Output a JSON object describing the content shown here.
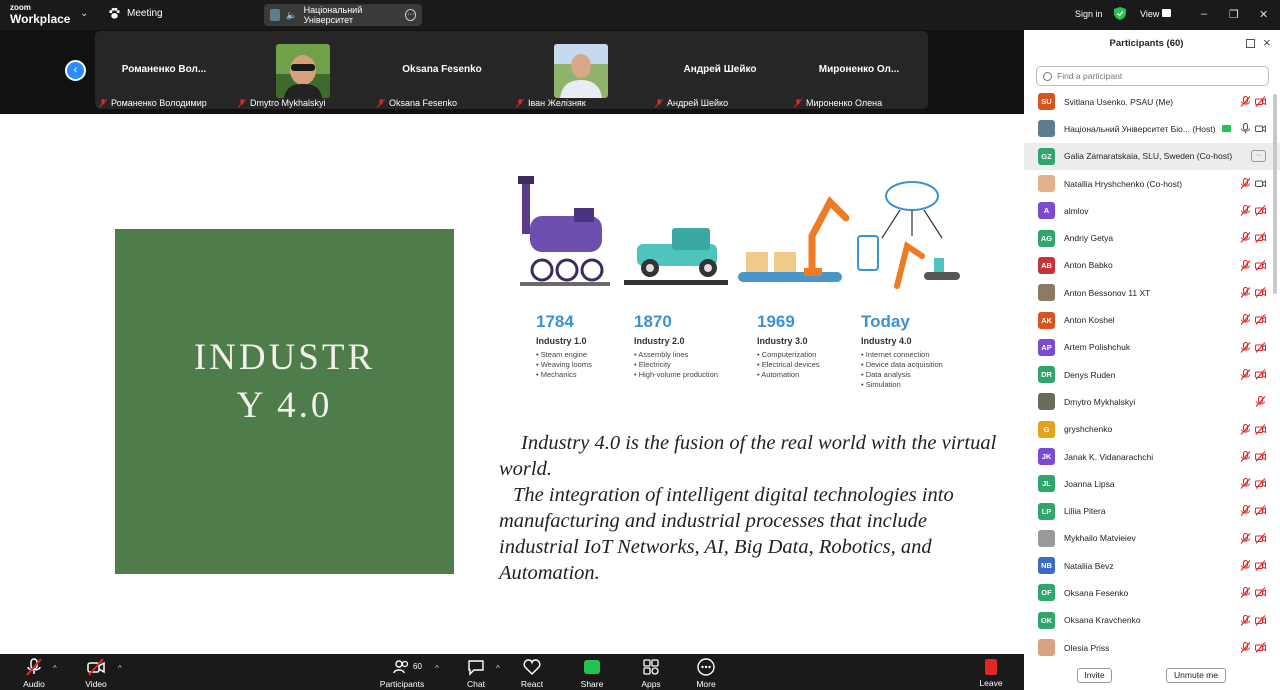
{
  "app": {
    "logo_line1": "zoom",
    "logo_line2": "Workplace",
    "meeting_label": "Meeting"
  },
  "speaker": {
    "name": "Національний Університет"
  },
  "top_right": {
    "signin": "Sign in",
    "view": "View"
  },
  "gallery": [
    {
      "big": "Романенко  Вол...",
      "label": "Романенко Володимир",
      "photo": false
    },
    {
      "big": "",
      "label": "Dmytro Mykhalskyi",
      "photo": true
    },
    {
      "big": "Oksana Fesenko",
      "label": "Oksana Fesenko",
      "photo": false
    },
    {
      "big": "",
      "label": "Іван Желізняк",
      "photo": true
    },
    {
      "big": "Андрей Шейко",
      "label": "Андрей Шейко",
      "photo": false
    },
    {
      "big": "Мироненко  Ол...",
      "label": "Мироненко Олена",
      "photo": false
    }
  ],
  "slide": {
    "title_line1": "INDUSTR",
    "title_line2": "Y 4.0",
    "timeline": [
      {
        "year": "1784",
        "title": "Industry 1.0",
        "items": [
          "Steam engine",
          "Weaving looms",
          "Mechanics"
        ]
      },
      {
        "year": "1870",
        "title": "Industry 2.0",
        "items": [
          "Assembly lines",
          "Electricity",
          "High-volume production"
        ]
      },
      {
        "year": "1969",
        "title": "Industry 3.0",
        "items": [
          "Computerization",
          "Electrical devices",
          "Automation"
        ]
      },
      {
        "year": "Today",
        "title": "Industry 4.0",
        "items": [
          "Internet connection",
          "Device data acquisition",
          "Data analysis",
          "Simulation"
        ]
      }
    ],
    "quote_p1": "Industry 4.0 is the fusion of the real world with the virtual world.",
    "quote_p2": "The integration of intelligent digital technologies into manufacturing and industrial processes that include industrial IoT Networks, AI, Big Data, Robotics, and Automation."
  },
  "toolbar": {
    "audio": "Audio",
    "video": "Video",
    "participants": "Participants",
    "participants_count": "60",
    "chat": "Chat",
    "react": "React",
    "share": "Share",
    "apps": "Apps",
    "more": "More",
    "leave": "Leave"
  },
  "panel": {
    "title": "Participants (60)",
    "search_placeholder": "Find a participant",
    "invite": "Invite",
    "unmute_me": "Unmute me",
    "participants": [
      {
        "initials": "SU",
        "color": "#d9531e",
        "name": "Svitlana Usenko. PSAU (Me)",
        "state": "muted"
      },
      {
        "initials": "",
        "color": "#5d7e92",
        "name": "Національний Університет Біо...  (Host)",
        "state": "host"
      },
      {
        "initials": "GZ",
        "color": "#2fa66b",
        "name": "Galia Zamaratskaia, SLU, Sweden (Co-host)",
        "state": "more"
      },
      {
        "initials": "",
        "color": "#e2b08a",
        "name": "Natallia Hryshchenko (Co-host)",
        "state": "mutedcam"
      },
      {
        "initials": "A",
        "color": "#7b4bd6",
        "name": "almlov",
        "state": "muted"
      },
      {
        "initials": "AG",
        "color": "#2fa66b",
        "name": "Andriy Getya",
        "state": "muted"
      },
      {
        "initials": "AB",
        "color": "#c8333a",
        "name": "Anton Babko",
        "state": "muted"
      },
      {
        "initials": "",
        "color": "#8d7a62",
        "name": "Anton Bessonov 11 ХТ",
        "state": "muted"
      },
      {
        "initials": "AK",
        "color": "#d9531e",
        "name": "Anton Koshel",
        "state": "muted"
      },
      {
        "initials": "AP",
        "color": "#7b4bd6",
        "name": "Artem Polishchuk",
        "state": "muted"
      },
      {
        "initials": "DR",
        "color": "#2fa66b",
        "name": "Denys Ruden",
        "state": "muted"
      },
      {
        "initials": "",
        "color": "#6b6b5a",
        "name": "Dmytro Mykhalskyi",
        "state": "miconly"
      },
      {
        "initials": "G",
        "color": "#e6a21a",
        "name": "gryshchenko",
        "state": "muted"
      },
      {
        "initials": "JK",
        "color": "#7b4bd6",
        "name": "Janak K. Vidanarachchi",
        "state": "muted"
      },
      {
        "initials": "JL",
        "color": "#2fa66b",
        "name": "Joanna Lipsa",
        "state": "muted"
      },
      {
        "initials": "LP",
        "color": "#2fa66b",
        "name": "Liliia Pitera",
        "state": "muted"
      },
      {
        "initials": "",
        "color": "#9a9a9a",
        "name": "Mykhailo Matvieiev",
        "state": "muted"
      },
      {
        "initials": "NB",
        "color": "#3b6bc4",
        "name": "Nataliia Bevz",
        "state": "muted"
      },
      {
        "initials": "OF",
        "color": "#2fa66b",
        "name": "Oksana Fesenko",
        "state": "muted"
      },
      {
        "initials": "OK",
        "color": "#2fa66b",
        "name": "Oksana Kravchenko",
        "state": "muted"
      },
      {
        "initials": "",
        "color": "#d9a184",
        "name": "Olesia Priss",
        "state": "muted"
      }
    ]
  }
}
